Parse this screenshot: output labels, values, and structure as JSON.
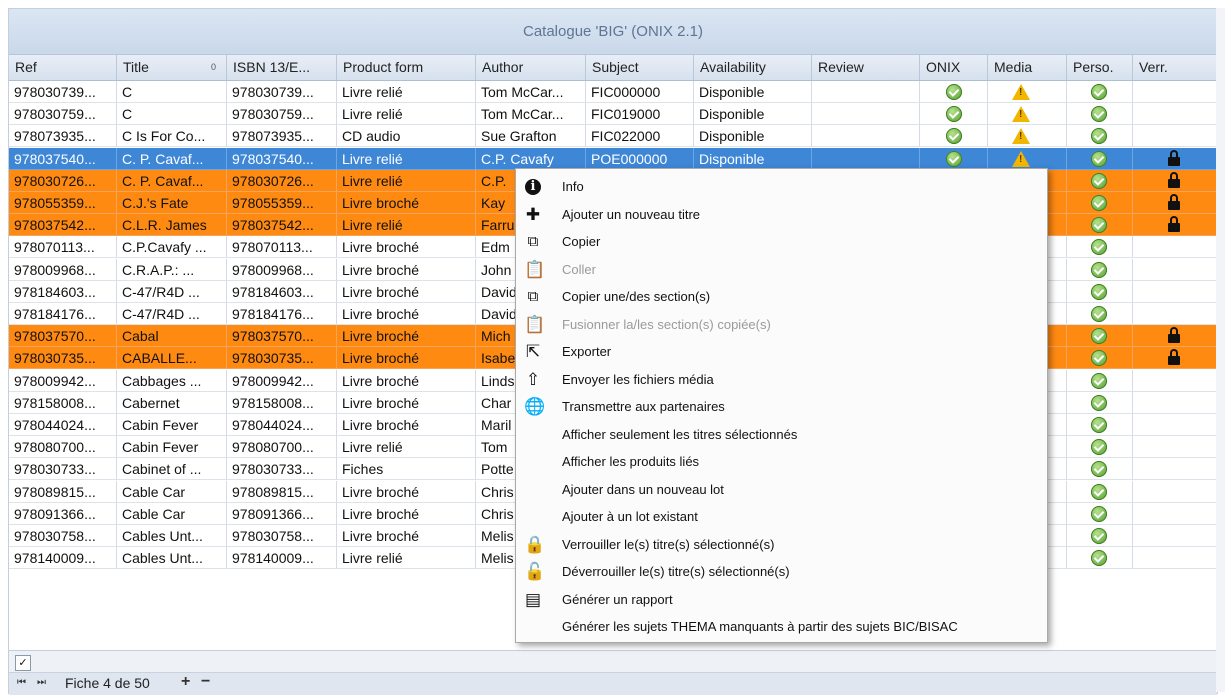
{
  "window": {
    "title": "Catalogue 'BIG' (ONIX 2.1)"
  },
  "columns": [
    "Ref",
    "Title",
    "ISBN 13/E...",
    "Product form",
    "Author",
    "Subject",
    "Availability",
    "Review",
    "ONIX",
    "Media",
    "Perso.",
    "Verr."
  ],
  "sort_indicator": "0",
  "rows": [
    [
      "978030739...",
      "C",
      "978030739...",
      "Livre relié",
      "Tom McCar...",
      "FIC000000",
      "Disponible"
    ],
    [
      "978030759...",
      "C",
      "978030759...",
      "Livre relié",
      "Tom McCar...",
      "FIC019000",
      "Disponible"
    ],
    [
      "978073935...",
      "C Is For Co...",
      "978073935...",
      "CD audio",
      "Sue Grafton",
      "FIC022000",
      "Disponible"
    ],
    [
      "978037540...",
      "C. P. Cavaf...",
      "978037540...",
      "Livre relié",
      "C.P. Cavafy",
      "POE000000",
      "Disponible"
    ],
    [
      "978030726...",
      "C. P. Cavaf...",
      "978030726...",
      "Livre relié",
      "C.P.",
      "",
      ""
    ],
    [
      "978055359...",
      "C.J.'s Fate",
      "978055359...",
      "Livre broché",
      "Kay",
      "",
      ""
    ],
    [
      "978037542...",
      "C.L.R. James",
      "978037542...",
      "Livre relié",
      "Farru",
      "",
      ""
    ],
    [
      "978070113...",
      "C.P.Cavafy ...",
      "978070113...",
      "Livre broché",
      "Edm",
      "",
      ""
    ],
    [
      "978009968...",
      "C.R.A.P.: ...",
      "978009968...",
      "Livre broché",
      "John",
      "",
      ""
    ],
    [
      "978184603...",
      "C-47/R4D ...",
      "978184603...",
      "Livre broché",
      "David",
      "",
      ""
    ],
    [
      "978184176...",
      "C-47/R4D ...",
      "978184176...",
      "Livre broché",
      "David",
      "",
      ""
    ],
    [
      "978037570...",
      "Cabal",
      "978037570...",
      "Livre broché",
      "Mich",
      "",
      ""
    ],
    [
      "978030735...",
      "CABALLE...",
      "978030735...",
      "Livre broché",
      "Isabe",
      "",
      ""
    ],
    [
      "978009942...",
      "Cabbages ...",
      "978009942...",
      "Livre broché",
      "Linds",
      "",
      ""
    ],
    [
      "978158008...",
      "Cabernet",
      "978158008...",
      "Livre broché",
      "Char",
      "",
      ""
    ],
    [
      "978044024...",
      "Cabin Fever",
      "978044024...",
      "Livre broché",
      "Maril",
      "",
      ""
    ],
    [
      "978080700...",
      "Cabin Fever",
      "978080700...",
      "Livre relié",
      "Tom",
      "",
      ""
    ],
    [
      "978030733...",
      "Cabinet of ...",
      "978030733...",
      "Fiches",
      "Potte",
      "",
      ""
    ],
    [
      "978089815...",
      "Cable Car",
      "978089815...",
      "Livre broché",
      "Chris",
      "",
      ""
    ],
    [
      "978091366...",
      "Cable Car",
      "978091366...",
      "Livre broché",
      "Chris",
      "",
      ""
    ],
    [
      "978030758...",
      "Cables Unt...",
      "978030758...",
      "Livre broché",
      "Melis",
      "",
      ""
    ],
    [
      "978140009...",
      "Cables Unt...",
      "978140009...",
      "Livre relié",
      "Melis",
      "",
      ""
    ]
  ],
  "row_state": [
    "",
    "",
    "",
    "sel",
    "org",
    "org",
    "org",
    "",
    "",
    "",
    "",
    "org",
    "org",
    "",
    "",
    "",
    "",
    "",
    "",
    "",
    "",
    ""
  ],
  "onix_ok_rows": [
    0,
    1,
    2,
    3
  ],
  "media_warn_rows": [
    0,
    1,
    2,
    3
  ],
  "perso_ok_rows": [
    0,
    1,
    2,
    3,
    4,
    5,
    6,
    7,
    8,
    9,
    10,
    11,
    12,
    13,
    14,
    15,
    16,
    17,
    18,
    19,
    20,
    21
  ],
  "locked_rows": [
    3,
    4,
    5,
    6,
    11,
    12
  ],
  "context_menu": [
    {
      "icon": "info-icon",
      "glyph": "i",
      "label": "Info",
      "disabled": false
    },
    {
      "icon": "plus-icon",
      "glyph": "✚",
      "label": "Ajouter un nouveau titre",
      "disabled": false
    },
    {
      "icon": "copy-icon",
      "glyph": "⧉",
      "label": "Copier",
      "disabled": false
    },
    {
      "icon": "paste-icon",
      "glyph": "📋",
      "label": "Coller",
      "disabled": true
    },
    {
      "icon": "copy-sections-icon",
      "glyph": "⧉",
      "label": "Copier une/des section(s)",
      "disabled": false
    },
    {
      "icon": "merge-icon",
      "glyph": "📋",
      "label": "Fusionner la/les section(s) copiée(s)",
      "disabled": true
    },
    {
      "icon": "export-icon",
      "glyph": "⇱",
      "label": "Exporter",
      "disabled": false
    },
    {
      "icon": "upload-media-icon",
      "glyph": "⇧",
      "label": "Envoyer les fichiers média",
      "disabled": false
    },
    {
      "icon": "globe-icon",
      "glyph": "🌐",
      "label": "Transmettre aux partenaires",
      "disabled": false
    },
    {
      "icon": "",
      "glyph": "",
      "label": "Afficher seulement les titres sélectionnés",
      "disabled": false
    },
    {
      "icon": "",
      "glyph": "",
      "label": "Afficher les produits liés",
      "disabled": false
    },
    {
      "icon": "",
      "glyph": "",
      "label": "Ajouter dans un nouveau lot",
      "disabled": false
    },
    {
      "icon": "",
      "glyph": "",
      "label": "Ajouter à un lot existant",
      "disabled": false
    },
    {
      "icon": "lock-icon",
      "glyph": "🔒",
      "label": "Verrouiller le(s) titre(s) sélectionné(s)",
      "disabled": false
    },
    {
      "icon": "unlock-icon",
      "glyph": "🔓",
      "label": "Déverrouiller le(s) titre(s) sélectionné(s)",
      "disabled": false
    },
    {
      "icon": "report-icon",
      "glyph": "▤",
      "label": "Générer un rapport",
      "disabled": false
    },
    {
      "icon": "",
      "glyph": "",
      "label": "Générer les sujets THEMA manquants à partir des sujets BIC/BISAC",
      "disabled": false
    }
  ],
  "footer": {
    "check_glyph": "✓",
    "record_text": "Fiche 4 de 50",
    "first_glyph": "⏮",
    "prev_glyph": "⏭",
    "add_glyph": "+",
    "remove_glyph": "−"
  }
}
